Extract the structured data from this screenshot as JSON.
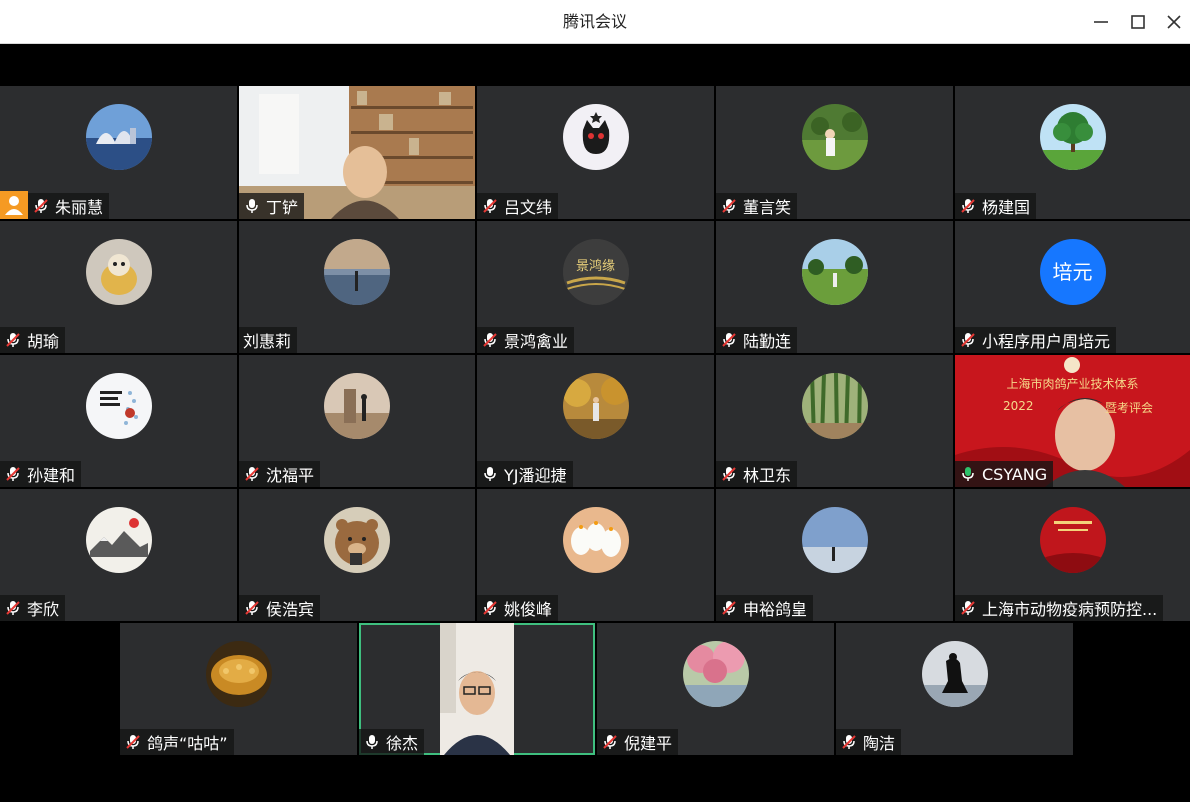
{
  "window": {
    "title": "腾讯会议",
    "controls": [
      "minimize-icon",
      "maximize-icon",
      "close-icon"
    ]
  },
  "participants": [
    {
      "name": "朱丽慧",
      "mic": "muted",
      "host_icon": true,
      "avatar": "city-night"
    },
    {
      "name": "丁铲",
      "mic": "on",
      "avatar": "video"
    },
    {
      "name": "吕文纬",
      "mic": "muted",
      "avatar": "black-cat"
    },
    {
      "name": "董言笑",
      "mic": "muted",
      "avatar": "child-garden"
    },
    {
      "name": "杨建国",
      "mic": "muted",
      "avatar": "tree"
    },
    {
      "name": "胡瑜",
      "mic": "muted",
      "avatar": "toy"
    },
    {
      "name": "刘惠莉",
      "mic": "none",
      "avatar": "sunset-lake"
    },
    {
      "name": "景鸿禽业",
      "mic": "muted",
      "avatar": "logo-calligraphy"
    },
    {
      "name": "陆勤连",
      "mic": "muted",
      "avatar": "meadow"
    },
    {
      "name": "小程序用户周培元",
      "mic": "muted",
      "avatar": "text",
      "avatar_text": "培元"
    },
    {
      "name": "孙建和",
      "mic": "muted",
      "avatar": "poster"
    },
    {
      "name": "沈福平",
      "mic": "muted",
      "avatar": "monument"
    },
    {
      "name": "YJ潘迎捷",
      "mic": "on",
      "avatar": "autumn-trees"
    },
    {
      "name": "林卫东",
      "mic": "muted",
      "avatar": "bamboo"
    },
    {
      "name": "CSYANG",
      "mic": "speaking",
      "avatar": "video"
    },
    {
      "name": "李欣",
      "mic": "muted",
      "avatar": "ink-painting"
    },
    {
      "name": "侯浩宾",
      "mic": "muted",
      "avatar": "bear"
    },
    {
      "name": "姚俊峰",
      "mic": "muted",
      "avatar": "geese"
    },
    {
      "name": "申裕鸽皇",
      "mic": "muted",
      "avatar": "sky"
    },
    {
      "name": "上海市动物疫病预防控...",
      "mic": "muted",
      "avatar": "red-poster"
    },
    {
      "name": "鸽声“咕咕”",
      "mic": "muted",
      "avatar": "gold-carving"
    },
    {
      "name": "徐杰",
      "mic": "on",
      "avatar": "video",
      "active_speaker": true
    },
    {
      "name": "倪建平",
      "mic": "muted",
      "avatar": "blossom"
    },
    {
      "name": "陶洁",
      "mic": "muted",
      "avatar": "silhouette"
    }
  ],
  "video_overlays": {
    "csyang_banner_line1": "上海市肉鸽产业技术体系",
    "csyang_banner_line2": "2022",
    "csyang_banner_line3": "暨考评会",
    "jinghong_logo": "景鸿缘"
  },
  "colors": {
    "tile_bg": "#2c2d2f",
    "speaking": "#2ec26b",
    "active_border": "#3fbf7f",
    "host_badge": "#f59a23",
    "text_avatar": "#1677ff"
  }
}
